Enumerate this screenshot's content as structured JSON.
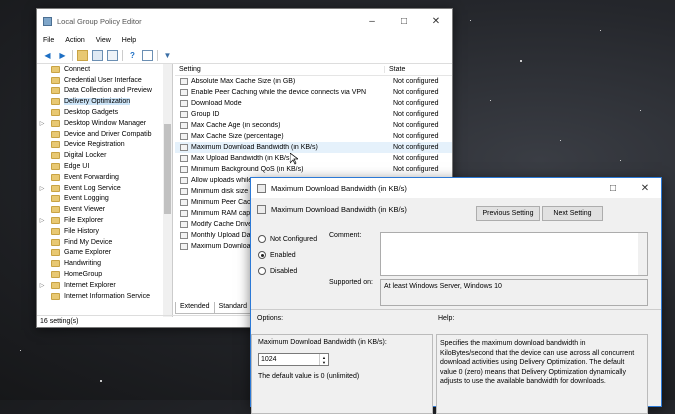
{
  "main_window": {
    "title": "Local Group Policy Editor",
    "menu": [
      "File",
      "Action",
      "View",
      "Help"
    ],
    "tree_items": [
      {
        "label": "Connect",
        "expandable": false,
        "selected": false
      },
      {
        "label": "Credential User Interface",
        "expandable": false,
        "selected": false
      },
      {
        "label": "Data Collection and Preview",
        "expandable": false,
        "selected": false
      },
      {
        "label": "Delivery Optimization",
        "expandable": false,
        "selected": true
      },
      {
        "label": "Desktop Gadgets",
        "expandable": false,
        "selected": false
      },
      {
        "label": "Desktop Window Manager",
        "expandable": true,
        "selected": false
      },
      {
        "label": "Device and Driver Compatib",
        "expandable": false,
        "selected": false
      },
      {
        "label": "Device Registration",
        "expandable": false,
        "selected": false
      },
      {
        "label": "Digital Locker",
        "expandable": false,
        "selected": false
      },
      {
        "label": "Edge UI",
        "expandable": false,
        "selected": false
      },
      {
        "label": "Event Forwarding",
        "expandable": false,
        "selected": false
      },
      {
        "label": "Event Log Service",
        "expandable": true,
        "selected": false
      },
      {
        "label": "Event Logging",
        "expandable": false,
        "selected": false
      },
      {
        "label": "Event Viewer",
        "expandable": false,
        "selected": false
      },
      {
        "label": "File Explorer",
        "expandable": true,
        "selected": false
      },
      {
        "label": "File History",
        "expandable": false,
        "selected": false
      },
      {
        "label": "Find My Device",
        "expandable": false,
        "selected": false
      },
      {
        "label": "Game Explorer",
        "expandable": false,
        "selected": false
      },
      {
        "label": "Handwriting",
        "expandable": false,
        "selected": false
      },
      {
        "label": "HomeGroup",
        "expandable": false,
        "selected": false
      },
      {
        "label": "Internet Explorer",
        "expandable": true,
        "selected": false
      },
      {
        "label": "Internet Information Service",
        "expandable": false,
        "selected": false
      }
    ],
    "list_headers": {
      "setting": "Setting",
      "state": "State"
    },
    "settings": [
      {
        "name": "Absolute Max Cache Size (in GB)",
        "state": "Not configured"
      },
      {
        "name": "Enable Peer Caching while the device connects via VPN",
        "state": "Not configured"
      },
      {
        "name": "Download Mode",
        "state": "Not configured"
      },
      {
        "name": "Group ID",
        "state": "Not configured"
      },
      {
        "name": "Max Cache Age (in seconds)",
        "state": "Not configured"
      },
      {
        "name": "Max Cache Size (percentage)",
        "state": "Not configured"
      },
      {
        "name": "Maximum Download Bandwidth (in KB/s)",
        "state": "Not configured"
      },
      {
        "name": "Max Upload Bandwidth (in KB/s)",
        "state": "Not configured"
      },
      {
        "name": "Minimum Background QoS (in KB/s)",
        "state": "Not configured"
      },
      {
        "name": "Allow uploads while the device is on battery",
        "state": ""
      },
      {
        "name": "Minimum disk size allowed to use Peer Caching",
        "state": ""
      },
      {
        "name": "Minimum Peer Caching Content File Size",
        "state": ""
      },
      {
        "name": "Minimum RAM capacity",
        "state": ""
      },
      {
        "name": "Modify Cache Drive",
        "state": ""
      },
      {
        "name": "Monthly Upload Data Cap",
        "state": ""
      },
      {
        "name": "Maximum Download Bandwidth",
        "state": ""
      }
    ],
    "tabs": [
      "Extended",
      "Standard"
    ],
    "status": "16 setting(s)"
  },
  "dialog": {
    "title": "Maximum Download Bandwidth (in KB/s)",
    "header": "Maximum Download Bandwidth (in KB/s)",
    "prev_button": "Previous Setting",
    "next_button": "Next Setting",
    "radio_not_configured": "Not Configured",
    "radio_enabled": "Enabled",
    "radio_disabled": "Disabled",
    "selected_option": "Enabled",
    "comment_label": "Comment:",
    "comment_value": "",
    "supported_label": "Supported on:",
    "supported_value": "At least Windows Server, Windows 10",
    "options_label": "Options:",
    "help_label": "Help:",
    "option_field_label": "Maximum Download Bandwidth (in KB/s):",
    "option_value": "1024",
    "option_default_text": "The default value is 0 (unlimited)",
    "help_text": "Specifies the maximum download bandwidth in KiloBytes/second that the device can use across all concurrent download activities using Delivery Optimization. The default value 0 (zero) means that Delivery Optimization dynamically adjusts to use the available bandwidth for downloads."
  }
}
